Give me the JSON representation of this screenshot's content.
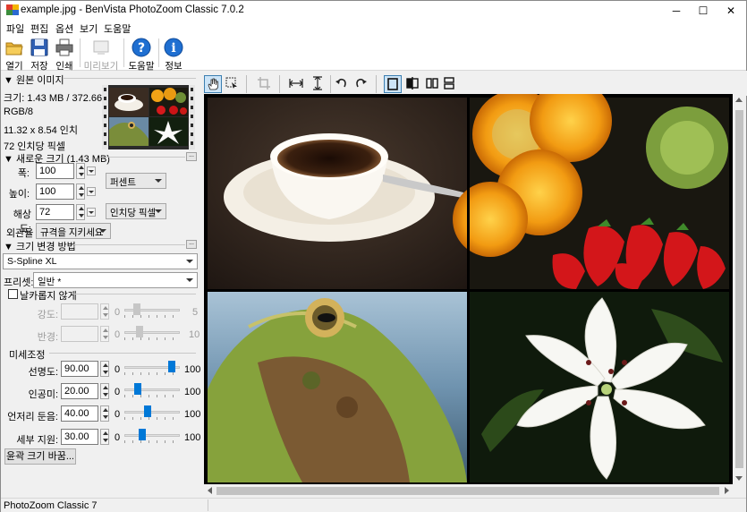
{
  "window": {
    "title": "example.jpg - BenVista PhotoZoom Classic 7.0.2",
    "controls": {
      "minimize": "─",
      "maximize": "☐",
      "close": "✕"
    }
  },
  "menu": [
    "파일",
    "편집",
    "옵션",
    "보기",
    "도움말"
  ],
  "toolbar": {
    "open": "열기",
    "save": "저장",
    "print": "인쇄",
    "preview": "미리보기",
    "help": "도움말",
    "info": "정보"
  },
  "original": {
    "header": "▼ 원본 이미지",
    "size": "크기: 1.43 MB / 372.66 KB",
    "mode": "RGB/8",
    "dimensions": "11.32 x 8.54 인치",
    "resolution": "72 인치당 픽셀"
  },
  "new_size": {
    "header": "▼ 새로운 크기 (1.43 MB)",
    "width_label": "폭:",
    "width_value": "100",
    "height_label": "높이:",
    "height_value": "100",
    "res_label": "해상도:",
    "res_value": "72",
    "unit": "퍼센트",
    "res_unit": "인치당 픽셀",
    "aspect_label": "외관율",
    "aspect_value": "규격을 지키세요"
  },
  "method": {
    "header": "▼ 크기 변경 방법",
    "algorithm": "S-Spline XL",
    "preset_label": "프리셋:",
    "preset_value": "일반 *",
    "unsharp_label": "날카롭지 않게",
    "strength_label": "강도:",
    "strength_min": "0",
    "strength_max": "5",
    "radius_label": "반경:",
    "radius_min": "0",
    "radius_max": "10",
    "fine_header": "미세조정",
    "sharpness_label": "선명도:",
    "sharpness_value": "90.00",
    "sharpness_level": 0.9,
    "film_label": "인공미:",
    "film_value": "20.00",
    "film_level": 0.2,
    "artifact_label": "언저리 둔음:",
    "artifact_value": "40.00",
    "artifact_level": 0.4,
    "detail_label": "세부 지원:",
    "detail_value": "30.00",
    "detail_level": 0.3,
    "min": "0",
    "max": "100",
    "resize_button": "윤곽 크기 바꿈..."
  },
  "status": "PhotoZoom Classic 7",
  "colors": {
    "accent": "#0078d7",
    "selected": "#cce4f7"
  }
}
